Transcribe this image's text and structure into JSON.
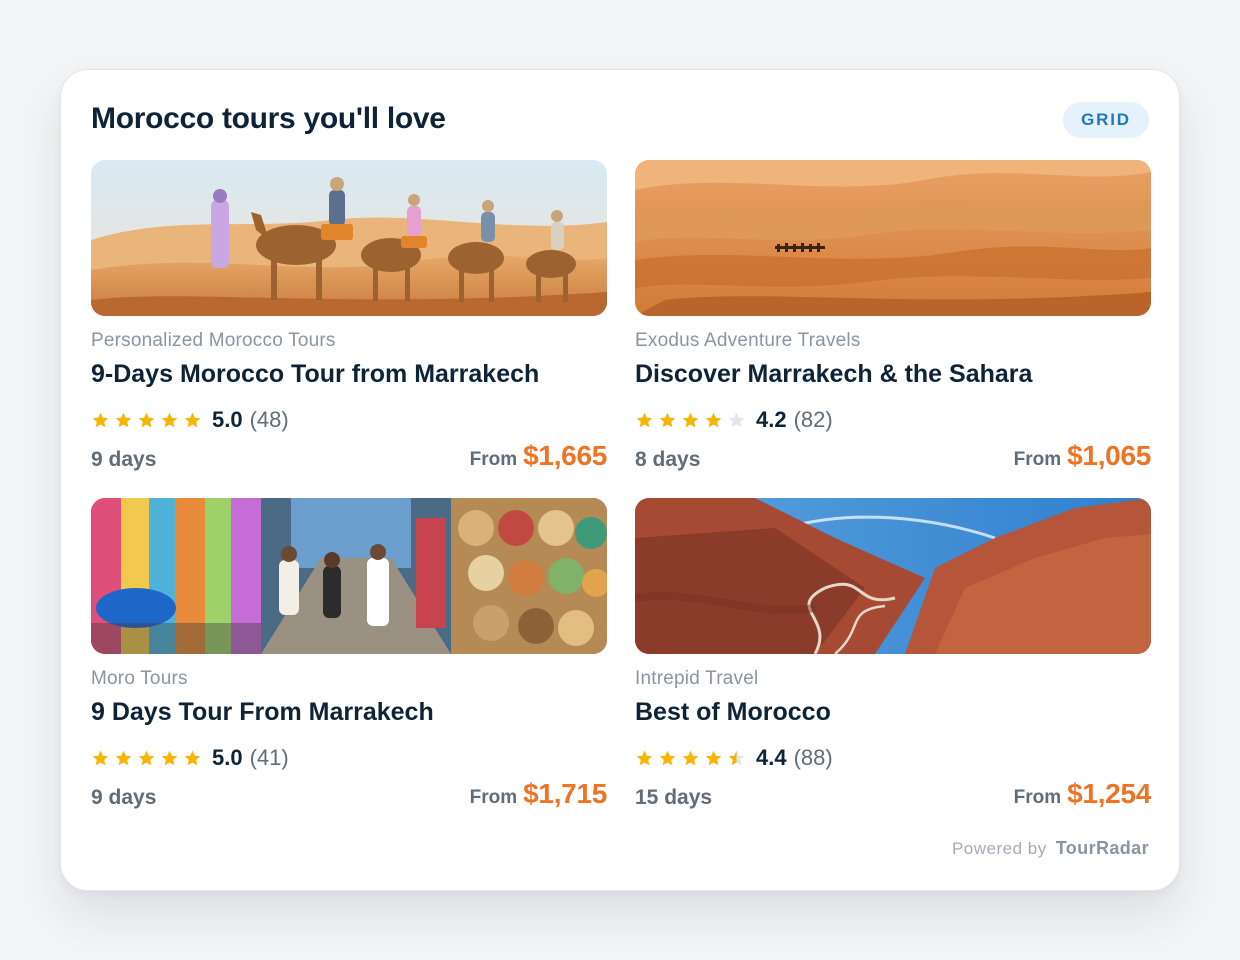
{
  "widget": {
    "title": "Morocco tours you'll love",
    "view_badge": "GRID",
    "powered_label": "Powered by",
    "powered_brand": "TourRadar"
  },
  "colors": {
    "title": "#0f2336",
    "price": "#ee7425",
    "star_filled": "#f7b500",
    "star_empty": "#e3e5e8",
    "badge_bg": "#e5f1fb",
    "badge_text": "#1e7ab9"
  },
  "tours": [
    {
      "image": "camel-caravan-desert-photo",
      "operator": "Personalized Morocco Tours",
      "name": "9-Days Morocco Tour from Marrakech",
      "stars": 5,
      "rating": "5.0",
      "reviews": "(48)",
      "duration": "9 days",
      "from_label": "From",
      "price": "$1,665"
    },
    {
      "image": "sahara-dunes-photo",
      "operator": "Exodus Adventure Travels",
      "name": "Discover Marrakech & the Sahara",
      "stars": 4,
      "rating": "4.2",
      "reviews": "(82)",
      "duration": "8 days",
      "from_label": "From",
      "price": "$1,065"
    },
    {
      "image": "market-street-photo",
      "operator": "Moro Tours",
      "name": "9 Days Tour From Marrakech",
      "stars": 5,
      "rating": "5.0",
      "reviews": "(41)",
      "duration": "9 days",
      "from_label": "From",
      "price": "$1,715"
    },
    {
      "image": "canyon-road-photo",
      "operator": "Intrepid Travel",
      "name": "Best of Morocco",
      "stars": 4.5,
      "rating": "4.4",
      "reviews": "(88)",
      "duration": "15 days",
      "from_label": "From",
      "price": "$1,254"
    }
  ]
}
